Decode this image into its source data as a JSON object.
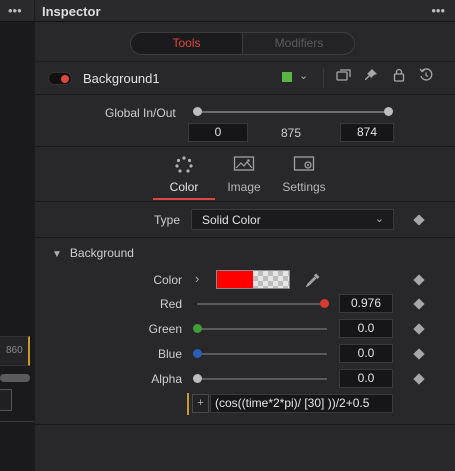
{
  "left_panel": {
    "frame_label": "860"
  },
  "inspector": {
    "title": "Inspector",
    "tabs": [
      {
        "label": "Tools",
        "active": true
      },
      {
        "label": "Modifiers",
        "active": false
      }
    ],
    "node": {
      "name": "Background1",
      "color_swatch": "#5bb543",
      "icons": [
        "toggle-icon",
        "color-chevron-icon",
        "versions-icon",
        "pin-icon",
        "lock-icon",
        "reset-icon"
      ]
    },
    "global_in_out": {
      "label": "Global In/Out",
      "in": "0",
      "duration": "875",
      "out": "874"
    },
    "sub_tabs": [
      {
        "label": "Color",
        "icon": "color-dots-icon",
        "active": true
      },
      {
        "label": "Image",
        "icon": "image-icon",
        "active": false
      },
      {
        "label": "Settings",
        "icon": "settings-gear-icon",
        "active": false
      }
    ],
    "type": {
      "label": "Type",
      "value": "Solid Color"
    },
    "section": {
      "title": "Background",
      "color_label": "Color",
      "channels": [
        {
          "label": "Red",
          "value": "0.976",
          "level": 0.976,
          "color": "#d43a2f"
        },
        {
          "label": "Green",
          "value": "0.0",
          "level": 0.0,
          "color": "#3f9e36"
        },
        {
          "label": "Blue",
          "value": "0.0",
          "level": 0.0,
          "color": "#2a5fb8"
        },
        {
          "label": "Alpha",
          "value": "0.0",
          "level": 0.0,
          "color": "#bdbdc1"
        }
      ],
      "expression": "(cos((time*2*pi)/ [30] ))/2+0.5"
    },
    "accent_color": "#e0463f"
  }
}
